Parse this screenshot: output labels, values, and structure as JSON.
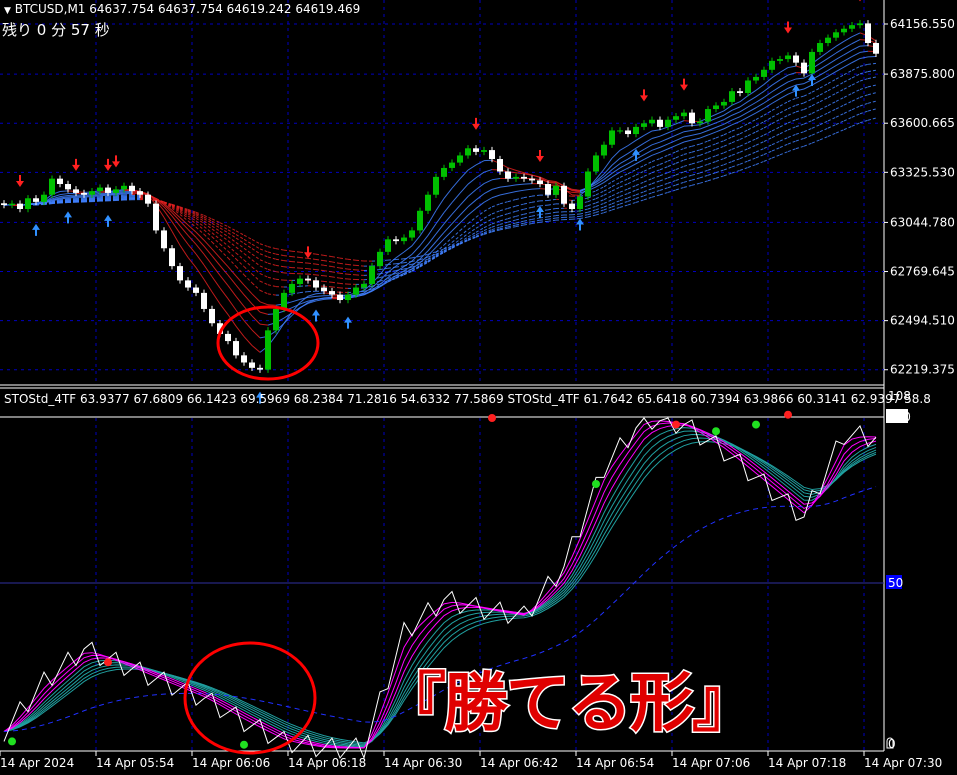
{
  "header": {
    "symbol_line": "BTCUSD,M1  64637.754 64637.754 64619.242 64619.469",
    "countdown": "残り 0 分 57 秒"
  },
  "indicator_header": "STOStd_4TF 63.9377 67.6809 66.1423 69.5969 68.2384 71.2816 54.6332 77.5869  STOStd_4TF 61.7642 65.6418 60.7394 63.9866 60.3141 62.9397 58.8",
  "caption": "『勝てる形』",
  "colors": {
    "bull": "#00c000",
    "bear": "#ffffff",
    "grid": "#0000c0",
    "ribbon_up": "#4080ff",
    "ribbon_down": "#e02020",
    "stoch_main": "#ffffff",
    "stoch_ribbon_a": "#ff00ff",
    "stoch_ribbon_b": "#20a0a0",
    "dot_red": "#ff2020",
    "dot_green": "#20e020",
    "circle": "#ff0000"
  },
  "chart_data": [
    {
      "type": "candlestick",
      "title": "BTCUSD,M1",
      "price_ticks": [
        "64156.550",
        "63875.800",
        "63600.665",
        "63325.530",
        "63044.780",
        "62769.645",
        "62494.510",
        "62219.375"
      ],
      "ylim": [
        62130,
        64240
      ],
      "time_ticks": [
        "14 Apr 2024",
        "14 Apr 05:54",
        "14 Apr 06:06",
        "14 Apr 06:18",
        "14 Apr 06:30",
        "14 Apr 06:42",
        "14 Apr 06:54",
        "14 Apr 07:06",
        "14 Apr 07:18",
        "14 Apr 07:30"
      ],
      "closes": [
        63142,
        63150,
        63120,
        63180,
        63160,
        63200,
        63290,
        63260,
        63230,
        63210,
        63200,
        63220,
        63240,
        63210,
        63230,
        63250,
        63220,
        63200,
        63150,
        63000,
        62900,
        62800,
        62720,
        62680,
        62650,
        62560,
        62480,
        62420,
        62380,
        62300,
        62260,
        62230,
        62220,
        62440,
        62560,
        62650,
        62700,
        62730,
        62720,
        62680,
        62660,
        62640,
        62610,
        62640,
        62680,
        62700,
        62800,
        62880,
        62950,
        62940,
        62960,
        63000,
        63110,
        63200,
        63300,
        63350,
        63380,
        63420,
        63460,
        63440,
        63450,
        63400,
        63330,
        63290,
        63300,
        63290,
        63280,
        63260,
        63200,
        63250,
        63150,
        63120,
        63190,
        63330,
        63420,
        63480,
        63560,
        63560,
        63540,
        63580,
        63600,
        63620,
        63580,
        63620,
        63640,
        63660,
        63600,
        63610,
        63680,
        63700,
        63720,
        63780,
        63770,
        63840,
        63860,
        63900,
        63950,
        63960,
        63980,
        63940,
        63880,
        64000,
        64050,
        64080,
        64110,
        64130,
        64150,
        64160,
        64050,
        63990
      ],
      "sell_arrows": [
        2,
        9,
        13,
        14,
        38,
        59,
        67,
        80,
        85,
        98,
        107
      ],
      "buy_arrows": [
        4,
        8,
        13,
        32,
        39,
        43,
        67,
        72,
        79,
        99,
        101
      ]
    },
    {
      "type": "line",
      "title": "STOStd_4TF",
      "ylim": [
        0,
        108
      ],
      "y_ticks": [
        "108",
        "100",
        "50",
        "0"
      ],
      "stoch_every5": [
        5,
        20,
        30,
        25,
        20,
        15,
        8,
        2,
        0,
        0,
        35,
        45,
        42,
        40,
        55,
        85,
        100,
        98,
        90,
        80,
        70,
        95,
        94,
        96,
        97,
        95
      ],
      "red_dots": [
        {
          "bar": 13,
          "value": 26
        },
        {
          "bar": 61,
          "value": 100
        },
        {
          "bar": 84,
          "value": 98
        },
        {
          "bar": 98,
          "value": 101
        }
      ],
      "green_dots": [
        {
          "bar": 1,
          "value": 2
        },
        {
          "bar": 30,
          "value": 1
        },
        {
          "bar": 74,
          "value": 80
        },
        {
          "bar": 89,
          "value": 96
        },
        {
          "bar": 94,
          "value": 98
        }
      ]
    }
  ]
}
